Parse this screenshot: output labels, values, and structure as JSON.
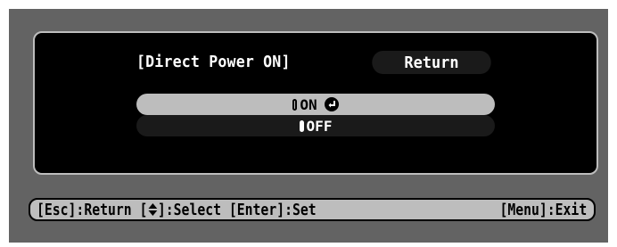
{
  "dialog": {
    "title": "[Direct Power ON]",
    "return_label": "Return",
    "options": [
      {
        "label": "ON",
        "selected": true,
        "icon": "enter-icon"
      },
      {
        "label": "OFF",
        "selected": false
      }
    ]
  },
  "statusbar": {
    "esc_text": "[Esc]:Return",
    "select_prefix": "[",
    "select_icon": "up-down-arrow-icon",
    "select_text": "]:Select",
    "enter_text": "[Enter]:Set",
    "menu_text": "[Menu]:Exit"
  },
  "colors": {
    "background": "#636363",
    "dialog": "#000000",
    "highlight": "#bdbdbd",
    "text_light": "#ffffff",
    "text_dark": "#000000"
  }
}
